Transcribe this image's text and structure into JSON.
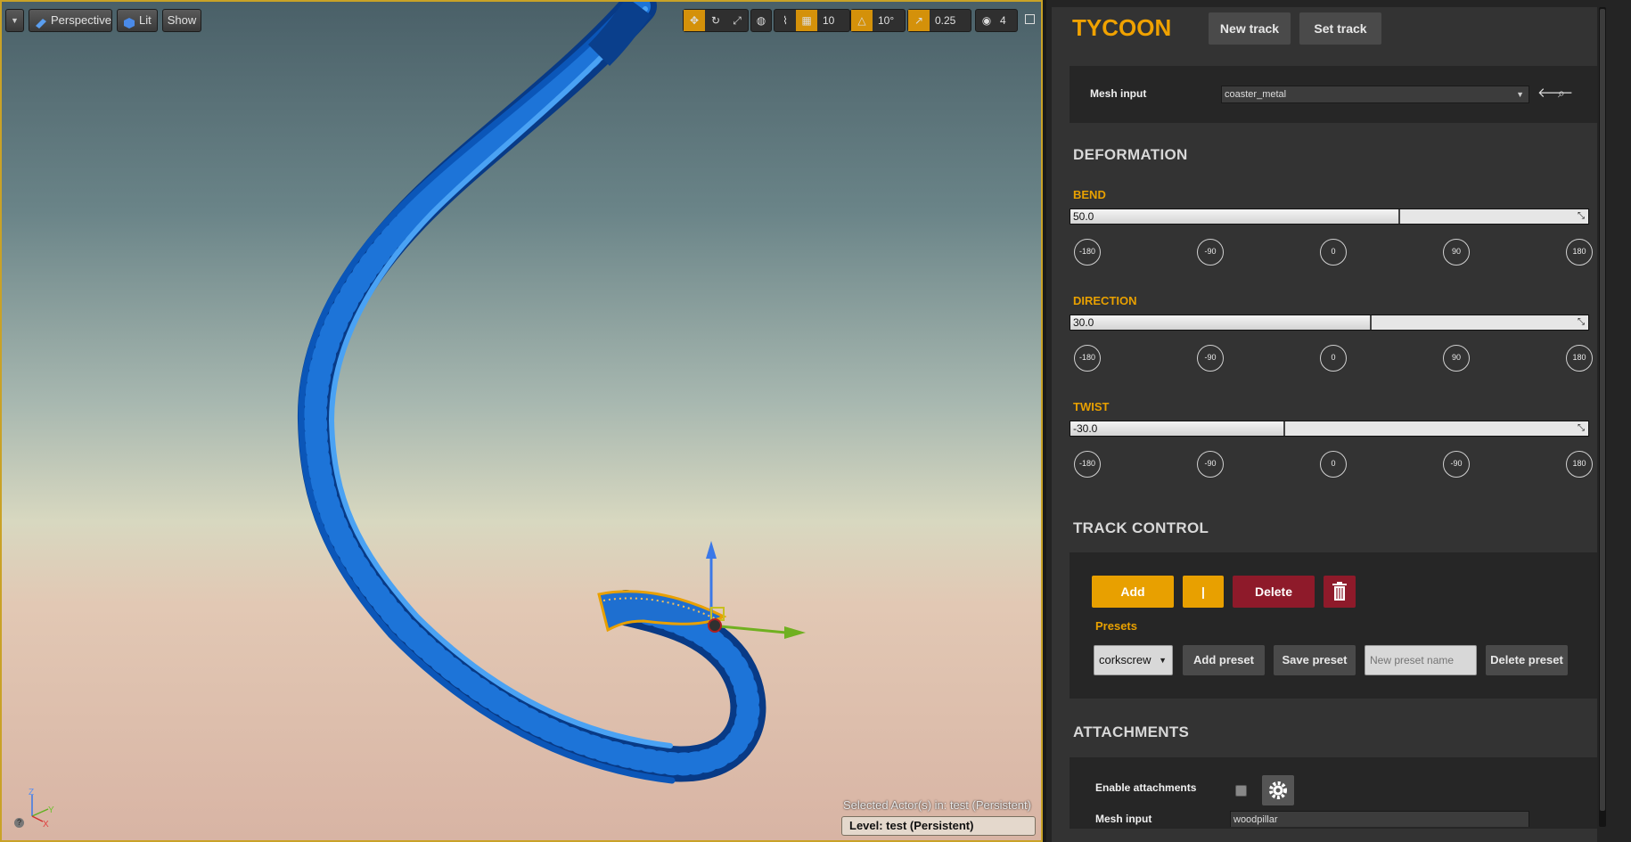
{
  "viewport": {
    "toolbar": {
      "menu_label": "",
      "perspective_label": "Perspective",
      "lit_label": "Lit",
      "show_label": "Show",
      "grid_value": "10",
      "rotation_value": "10°",
      "scale_value": "0.25",
      "camera_speed_value": "4"
    },
    "status": {
      "selected_actors": "Selected Actor(s) in:  test (Persistent)",
      "level": "Level:  test (Persistent)"
    },
    "axis": {
      "z": "Z",
      "y": "Y",
      "x": "X"
    }
  },
  "panel": {
    "title": "TYCOON",
    "new_track_label": "New track",
    "set_track_label": "Set track",
    "mesh_input_label": "Mesh input",
    "mesh_input_value": "coaster_metal",
    "deformation": {
      "heading": "DEFORMATION",
      "bend": {
        "label": "BEND",
        "value": "50.0",
        "ticks": [
          "-180",
          "-90",
          "0",
          "90",
          "180"
        ],
        "fraction": 0.637
      },
      "direction": {
        "label": "DIRECTION",
        "value": "30.0",
        "ticks": [
          "-180",
          "-90",
          "0",
          "90",
          "180"
        ],
        "fraction": 0.582
      },
      "twist": {
        "label": "TWIST",
        "value": "-30.0",
        "ticks": [
          "-180",
          "-90",
          "0",
          "-90",
          "180"
        ],
        "fraction": 0.415
      }
    },
    "track_control": {
      "heading": "TRACK CONTROL",
      "add_label": "Add",
      "separator_label": "|",
      "delete_label": "Delete",
      "presets_label": "Presets",
      "preset_selected": "corkscrew",
      "add_preset_label": "Add preset",
      "save_preset_label": "Save preset",
      "new_preset_placeholder": "New preset name",
      "delete_preset_label": "Delete preset"
    },
    "attachments": {
      "heading": "ATTACHMENTS",
      "enable_label": "Enable attachments",
      "mesh_input_label": "Mesh input",
      "mesh_input_value": "woodpillar"
    }
  },
  "colors": {
    "accent": "#f0a200",
    "delete": "#8e1a2a",
    "track_blue": "#1a6fd4",
    "selection_orange": "#e8a000"
  }
}
